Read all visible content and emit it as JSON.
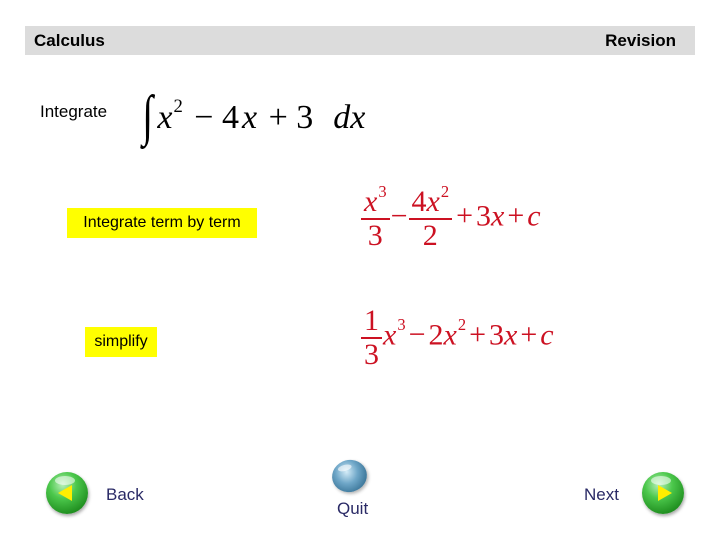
{
  "header": {
    "left_title": "Calculus",
    "right_title": "Revision",
    "background_color": "#dcdcdc"
  },
  "problem": {
    "label": "Integrate",
    "integral_symbol": "∫",
    "x": "x",
    "power": "2",
    "rest": "− 4",
    "x2": "x",
    "plus_const": "+ 3",
    "d": "d",
    "dx_var": "x",
    "latex": "\\int x^2 - 4x + 3 \\, dx"
  },
  "steps": [
    {
      "label": "Integrate term by term",
      "highlight_color": "#ffff00",
      "math": {
        "latex": "\\frac{x^3}{3} - \\frac{4x^2}{2} + 3x + c",
        "frac1_num_var": "x",
        "frac1_num_pow": "3",
        "frac1_den": "3",
        "minus": "−",
        "frac2_num_coef": "4",
        "frac2_num_var": "x",
        "frac2_num_pow": "2",
        "frac2_den": "2",
        "plus1": "+",
        "term3_coef": "3",
        "term3_var": "x",
        "plus2": "+",
        "const": "c"
      }
    },
    {
      "label": "simplify",
      "highlight_color": "#ffff00",
      "math": {
        "latex": "\\frac{1}{3}x^3 - 2x^2 + 3x + c",
        "frac_num": "1",
        "frac_den": "3",
        "t1_var": "x",
        "t1_pow": "3",
        "minus": "−",
        "t2_coef": "2",
        "t2_var": "x",
        "t2_pow": "2",
        "plus1": "+",
        "t3_coef": "3",
        "t3_var": "x",
        "plus2": "+",
        "const": "c"
      }
    }
  ],
  "math_color": "#cc1122",
  "navigation": {
    "back_label": "Back",
    "quit_label": "Quit",
    "next_label": "Next",
    "back_icon": "green-orb-left-arrow",
    "next_icon": "green-orb-right-arrow",
    "quit_icon": "blue-orb"
  }
}
